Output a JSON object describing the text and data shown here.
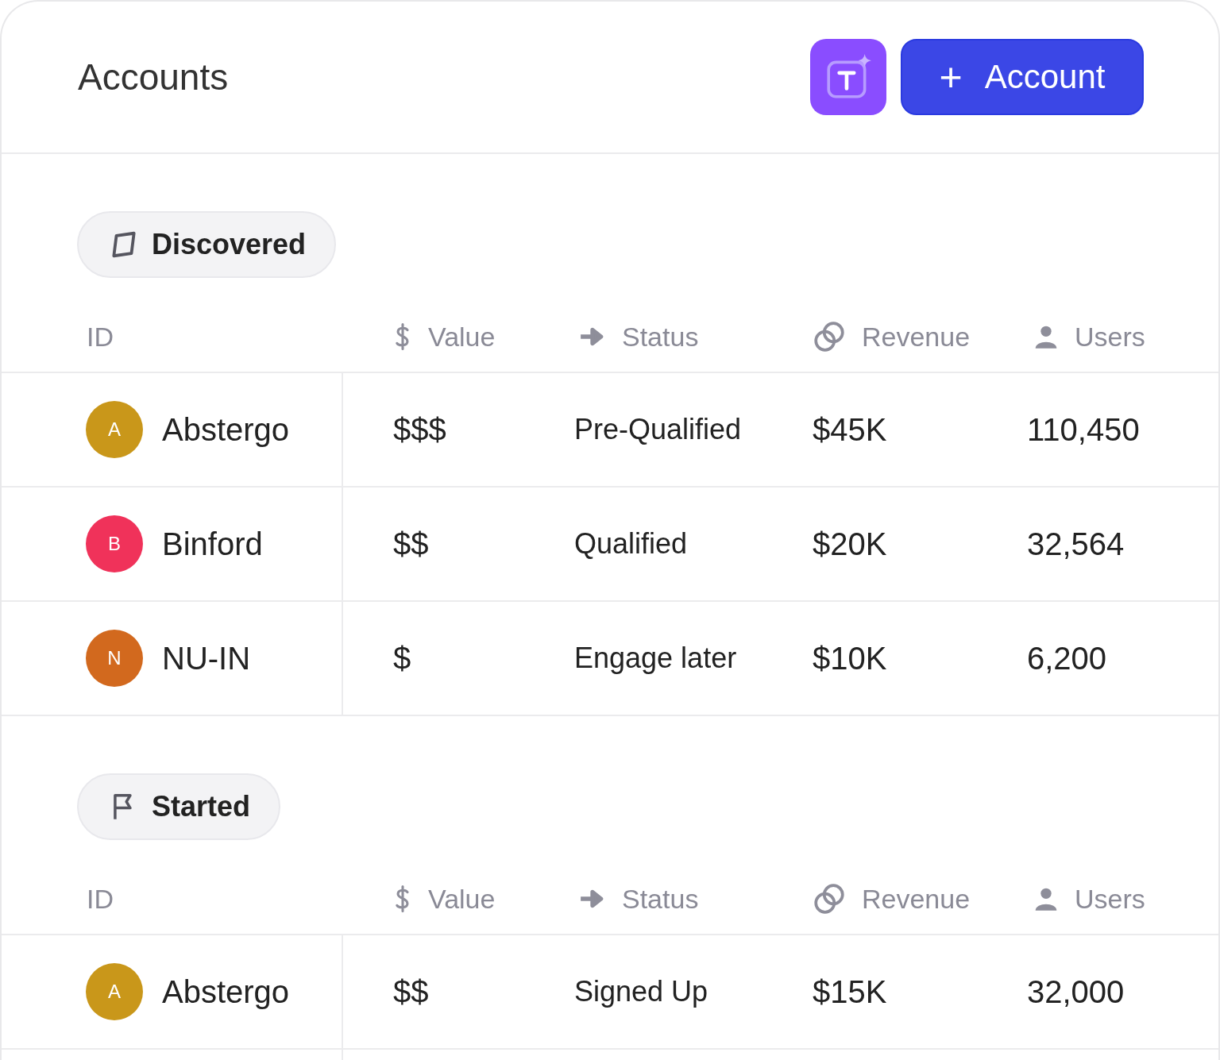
{
  "header": {
    "title": "Accounts",
    "add_button": {
      "icon": "+",
      "label": "Account"
    }
  },
  "groups": [
    {
      "label": "Discovered",
      "kind": "parallelogram",
      "columns": [
        {
          "label": "ID",
          "kind": "none"
        },
        {
          "label": "Value",
          "kind": "dollar"
        },
        {
          "label": "Status",
          "kind": "arrow"
        },
        {
          "label": "Revenue",
          "kind": "rings"
        },
        {
          "label": "Users",
          "kind": "person"
        }
      ],
      "rows": [
        {
          "initial": "A",
          "color": "#c9971a",
          "name": "Abstergo",
          "value": "$$$",
          "status": "Pre-Qualified",
          "revenue": "$45K",
          "users": "110,450"
        },
        {
          "initial": "B",
          "color": "#f0325a",
          "name": "Binford",
          "value": "$$",
          "status": "Qualified",
          "revenue": "$20K",
          "users": "32,564"
        },
        {
          "initial": "N",
          "color": "#d2691e",
          "name": "NU-IN",
          "value": "$",
          "status": "Engage later",
          "revenue": "$10K",
          "users": "6,200"
        }
      ]
    },
    {
      "label": "Started",
      "kind": "flag",
      "columns": [
        {
          "label": "ID",
          "kind": "none"
        },
        {
          "label": "Value",
          "kind": "dollar"
        },
        {
          "label": "Status",
          "kind": "arrow"
        },
        {
          "label": "Revenue",
          "kind": "rings"
        },
        {
          "label": "Users",
          "kind": "person"
        }
      ],
      "rows": [
        {
          "initial": "A",
          "color": "#c9971a",
          "name": "Abstergo",
          "value": "$$",
          "status": "Signed Up",
          "revenue": "$15K",
          "users": "32,000"
        }
      ]
    }
  ]
}
